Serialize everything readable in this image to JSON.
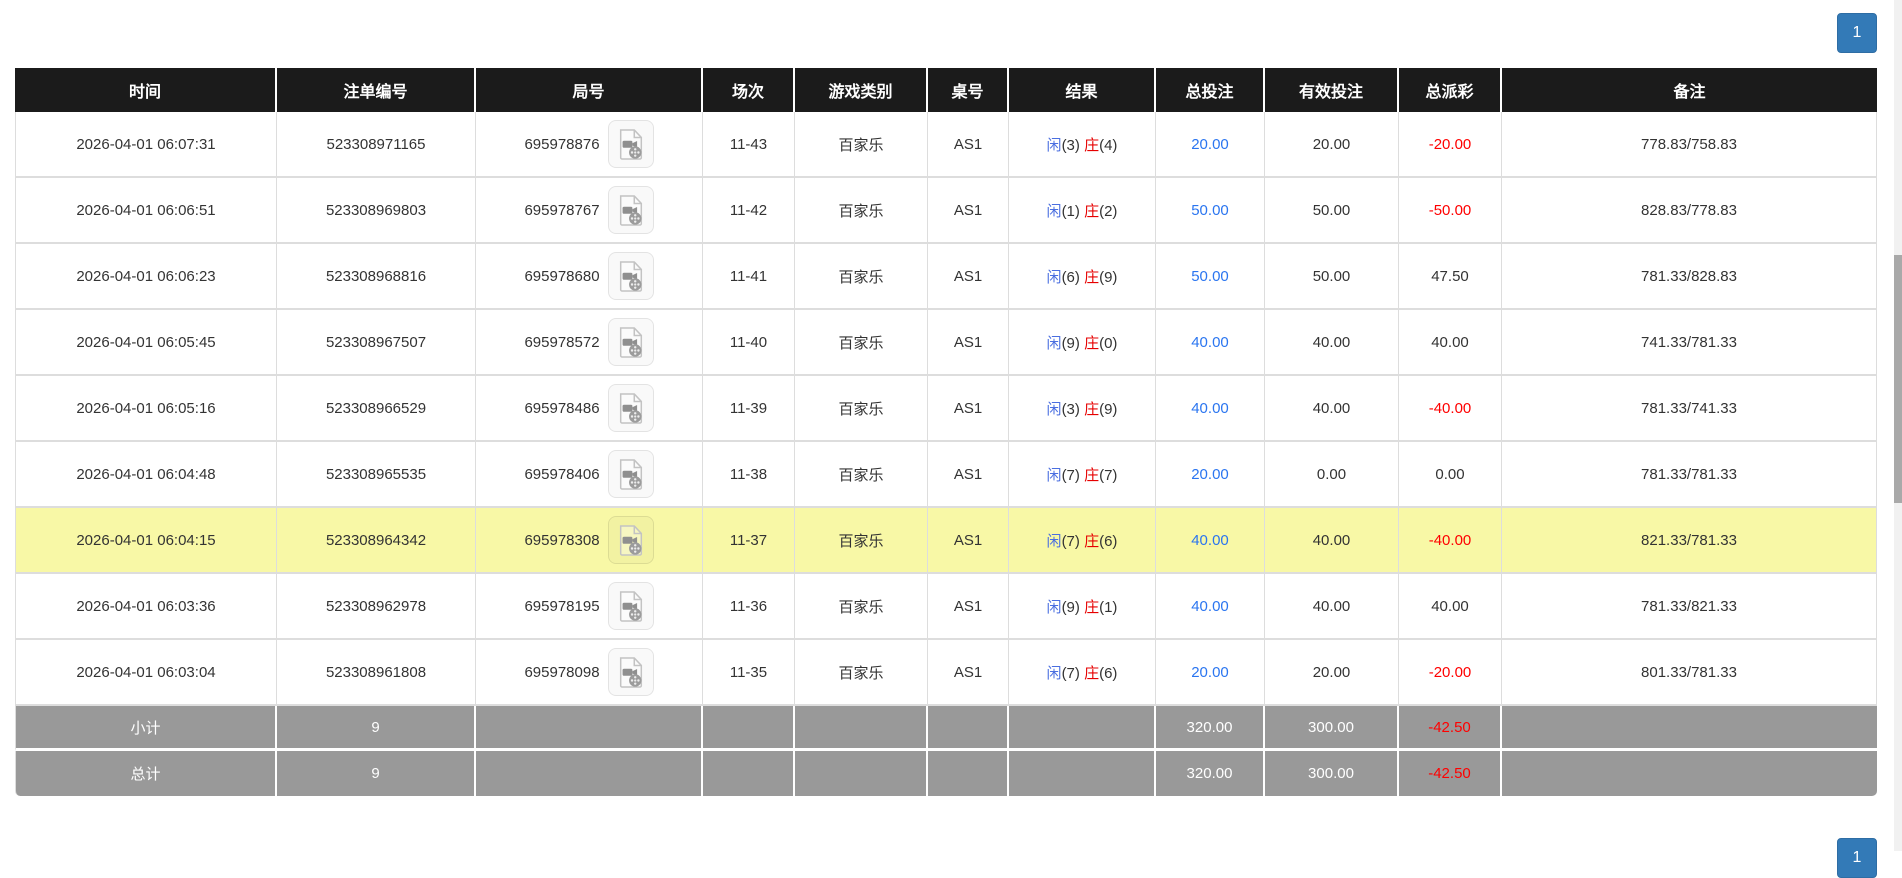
{
  "pagination": {
    "page": "1"
  },
  "table": {
    "headers": [
      "时间",
      "注单编号",
      "局号",
      "场次",
      "游戏类别",
      "桌号",
      "结果",
      "总投注",
      "有效投注",
      "总派彩",
      "备注"
    ],
    "rows": [
      {
        "time": "2026-04-01 06:07:31",
        "bet_id": "523308971165",
        "round_id": "695978876",
        "session": "11-43",
        "game_type": "百家乐",
        "table_no": "AS1",
        "player_label": "闲",
        "player_score": "(3)",
        "banker_label": "庄",
        "banker_score": "(4)",
        "total_bet": "20.00",
        "valid_bet": "20.00",
        "payout": "-20.00",
        "remark": "778.83/758.83",
        "highlighted": false
      },
      {
        "time": "2026-04-01 06:06:51",
        "bet_id": "523308969803",
        "round_id": "695978767",
        "session": "11-42",
        "game_type": "百家乐",
        "table_no": "AS1",
        "player_label": "闲",
        "player_score": "(1)",
        "banker_label": "庄",
        "banker_score": "(2)",
        "total_bet": "50.00",
        "valid_bet": "50.00",
        "payout": "-50.00",
        "remark": "828.83/778.83",
        "highlighted": false
      },
      {
        "time": "2026-04-01 06:06:23",
        "bet_id": "523308968816",
        "round_id": "695978680",
        "session": "11-41",
        "game_type": "百家乐",
        "table_no": "AS1",
        "player_label": "闲",
        "player_score": "(6)",
        "banker_label": "庄",
        "banker_score": "(9)",
        "total_bet": "50.00",
        "valid_bet": "50.00",
        "payout": "47.50",
        "remark": "781.33/828.83",
        "highlighted": false
      },
      {
        "time": "2026-04-01 06:05:45",
        "bet_id": "523308967507",
        "round_id": "695978572",
        "session": "11-40",
        "game_type": "百家乐",
        "table_no": "AS1",
        "player_label": "闲",
        "player_score": "(9)",
        "banker_label": "庄",
        "banker_score": "(0)",
        "total_bet": "40.00",
        "valid_bet": "40.00",
        "payout": "40.00",
        "remark": "741.33/781.33",
        "highlighted": false
      },
      {
        "time": "2026-04-01 06:05:16",
        "bet_id": "523308966529",
        "round_id": "695978486",
        "session": "11-39",
        "game_type": "百家乐",
        "table_no": "AS1",
        "player_label": "闲",
        "player_score": "(3)",
        "banker_label": "庄",
        "banker_score": "(9)",
        "total_bet": "40.00",
        "valid_bet": "40.00",
        "payout": "-40.00",
        "remark": "781.33/741.33",
        "highlighted": false
      },
      {
        "time": "2026-04-01 06:04:48",
        "bet_id": "523308965535",
        "round_id": "695978406",
        "session": "11-38",
        "game_type": "百家乐",
        "table_no": "AS1",
        "player_label": "闲",
        "player_score": "(7)",
        "banker_label": "庄",
        "banker_score": "(7)",
        "total_bet": "20.00",
        "valid_bet": "0.00",
        "payout": "0.00",
        "remark": "781.33/781.33",
        "highlighted": false
      },
      {
        "time": "2026-04-01 06:04:15",
        "bet_id": "523308964342",
        "round_id": "695978308",
        "session": "11-37",
        "game_type": "百家乐",
        "table_no": "AS1",
        "player_label": "闲",
        "player_score": "(7)",
        "banker_label": "庄",
        "banker_score": "(6)",
        "total_bet": "40.00",
        "valid_bet": "40.00",
        "payout": "-40.00",
        "remark": "821.33/781.33",
        "highlighted": true
      },
      {
        "time": "2026-04-01 06:03:36",
        "bet_id": "523308962978",
        "round_id": "695978195",
        "session": "11-36",
        "game_type": "百家乐",
        "table_no": "AS1",
        "player_label": "闲",
        "player_score": "(9)",
        "banker_label": "庄",
        "banker_score": "(1)",
        "total_bet": "40.00",
        "valid_bet": "40.00",
        "payout": "40.00",
        "remark": "781.33/821.33",
        "highlighted": false
      },
      {
        "time": "2026-04-01 06:03:04",
        "bet_id": "523308961808",
        "round_id": "695978098",
        "session": "11-35",
        "game_type": "百家乐",
        "table_no": "AS1",
        "player_label": "闲",
        "player_score": "(7)",
        "banker_label": "庄",
        "banker_score": "(6)",
        "total_bet": "20.00",
        "valid_bet": "20.00",
        "payout": "-20.00",
        "remark": "801.33/781.33",
        "highlighted": false
      }
    ],
    "summary_rows": [
      {
        "label": "小计",
        "count": "9",
        "total_bet": "320.00",
        "valid_bet": "300.00",
        "payout": "-42.50"
      },
      {
        "label": "总计",
        "count": "9",
        "total_bet": "320.00",
        "valid_bet": "300.00",
        "payout": "-42.50"
      }
    ]
  },
  "icons": {
    "round_video": "video-file-icon"
  },
  "colors": {
    "header_bg": "#1b1b1b",
    "row_highlight": "#f8f8a6",
    "summary_bg": "#999999",
    "bet_link_blue": "#2a75f0",
    "player_blue": "#4a6ee0",
    "banker_red": "#e60000",
    "negative_red": "#ff0000",
    "pagination_blue": "#337ab7"
  }
}
